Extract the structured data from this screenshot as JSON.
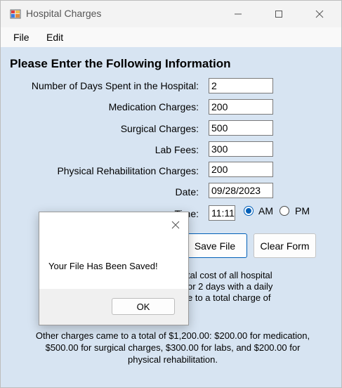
{
  "window": {
    "title": "Hospital Charges"
  },
  "menu": {
    "file": "File",
    "edit": "Edit"
  },
  "form": {
    "heading": "Please Enter the Following Information",
    "fields": [
      {
        "label": "Number of Days Spent in the Hospital:",
        "value": "2"
      },
      {
        "label": "Medication Charges:",
        "value": "200"
      },
      {
        "label": "Surgical Charges:",
        "value": "500"
      },
      {
        "label": "Lab Fees:",
        "value": "300"
      },
      {
        "label": "Physical Rehabilitation Charges:",
        "value": "200"
      },
      {
        "label": "Date:",
        "value": "09/28/2023"
      }
    ],
    "time_label": "Time:",
    "time_value": "11:11",
    "am": "AM",
    "pm": "PM",
    "am_selected": true,
    "save_button": "Save File",
    "clear_button": "Clear Form",
    "summary_lines": [
      "tal cost of all hospital",
      "or 2 days with a daily",
      "e to a total charge of"
    ],
    "other_charges": "Other charges came to a total of $1,200.00: $200.00 for medication, $500.00 for surgical charges, $300.00 for labs, and $200.00 for physical rehabilitation."
  },
  "dialog": {
    "message": "Your File Has Been Saved!",
    "ok": "OK"
  },
  "colors": {
    "accent": "#005fb8",
    "client_bg": "#d7e4f2"
  }
}
